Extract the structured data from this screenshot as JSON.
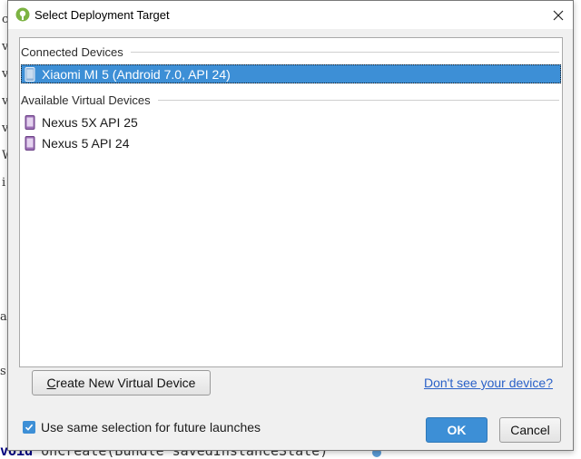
{
  "background": {
    "code_line_keyword": "void",
    "code_line_rest": " onCreate(Bundle savedInstanceState)",
    "fragments": [
      "c",
      "v",
      "v",
      "v",
      "v",
      "W",
      "i",
      "a",
      "s"
    ]
  },
  "dialog": {
    "title": "Select Deployment Target",
    "colors": {
      "accent": "#3d8fd6",
      "link": "#2a61c8",
      "android_green": "#7cb342"
    }
  },
  "connected": {
    "header": "Connected Devices",
    "devices": [
      {
        "label": "Xiaomi MI 5 (Android 7.0, API 24)",
        "icon": "phone-icon",
        "selected": true
      }
    ]
  },
  "virtual": {
    "header": "Available Virtual Devices",
    "devices": [
      {
        "label": "Nexus 5X API 25",
        "icon": "virtual-phone-icon"
      },
      {
        "label": "Nexus 5 API 24",
        "icon": "virtual-phone-icon"
      }
    ]
  },
  "buttons": {
    "create_mnemonic": "C",
    "create_rest": "reate New Virtual Device",
    "ok": "OK",
    "cancel": "Cancel"
  },
  "link": "Don't see your device?",
  "checkbox": {
    "label": "Use same selection for future launches",
    "checked": true
  }
}
